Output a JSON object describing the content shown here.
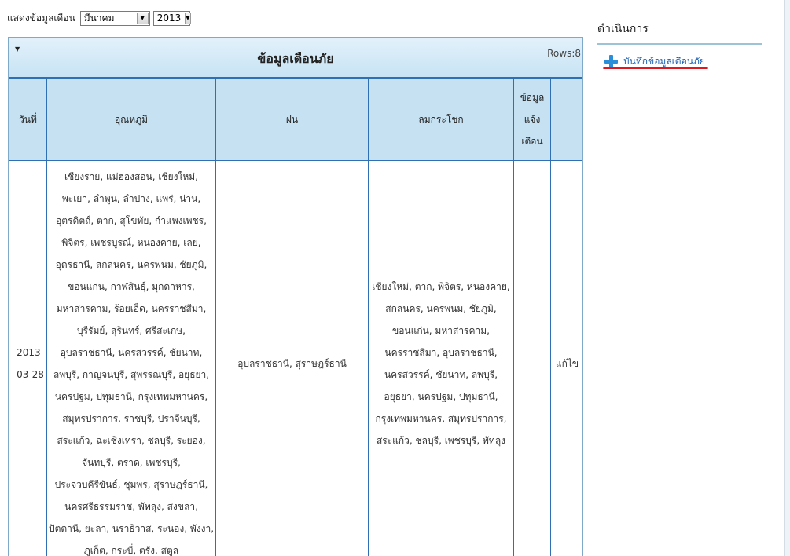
{
  "filter": {
    "label": "แสดงข้อมูลเดือน",
    "month": "มีนาคม",
    "year": "2013"
  },
  "panel": {
    "title": "ข้อมูลเตือนภัย",
    "rows": "Rows:8"
  },
  "table": {
    "headers": {
      "date": "วันที่",
      "temp": "อุณหภูมิ",
      "rain": "ฝน",
      "wind": "ลมกระโชก",
      "alert": [
        "ข้อมูล",
        "แจ้ง",
        "เตือน"
      ]
    },
    "row": {
      "date": [
        "2013-",
        "03-28"
      ],
      "temp": [
        "เชียงราย, แม่ฮ่องสอน, เชียงใหม่,",
        "พะเยา, ลำพูน, ลำปาง, แพร่, น่าน,",
        "อุตรดิตถ์, ตาก, สุโขทัย, กำแพงเพชร,",
        "พิจิตร, เพชรบูรณ์, หนองคาย, เลย,",
        "อุดรธานี, สกลนคร, นครพนม, ชัยภูมิ,",
        "ขอนแก่น, กาฬสินธุ์, มุกดาหาร,",
        "มหาสารคาม, ร้อยเอ็ด, นครราชสีมา,",
        "บุรีรัมย์, สุรินทร์, ศรีสะเกษ,",
        "อุบลราชธานี, นครสวรรค์, ชัยนาท,",
        "ลพบุรี, กาญจนบุรี, สุพรรณบุรี, อยุธยา,",
        "นครปฐม, ปทุมธานี, กรุงเทพมหานคร,",
        "สมุทรปราการ, ราชบุรี, ปราจีนบุรี,",
        "สระแก้ว, ฉะเชิงเทรา, ชลบุรี, ระยอง,",
        "จันทบุรี, ตราด, เพชรบุรี,",
        "ประจวบคีรีขันธ์, ชุมพร, สุราษฎร์ธานี,",
        "นครศรีธรรมราช, พัทลุง, สงขลา,",
        "ปัตตานี, ยะลา, นราธิวาส, ระนอง, พังงา,",
        "ภูเก็ต, กระบี่, ตรัง, สตูล"
      ],
      "rain": "อุบลราชธานี, สุราษฎร์ธานี",
      "wind": [
        "เชียงใหม่, ตาก, พิจิตร, หนองคาย,",
        "สกลนคร, นครพนม, ชัยภูมิ,",
        "ขอนแก่น, มหาสารคาม,",
        "นครราชสีมา, อุบลราชธานี,",
        "นครสวรรค์, ชัยนาท, ลพบุรี,",
        "อยุธยา, นครปฐม, ปทุมธานี,",
        "กรุงเทพมหานคร, สมุทรปราการ,",
        "สระแก้ว, ชลบุรี, เพชรบุรี, พัทลุง"
      ],
      "alert": "",
      "action": "แก้ไข"
    }
  },
  "sidebar": {
    "title": "ดำเนินการ",
    "add_link": "บันทึกข้อมูลเตือนภัย",
    "add_icon": "plus-icon",
    "accent": "#e0181f"
  }
}
